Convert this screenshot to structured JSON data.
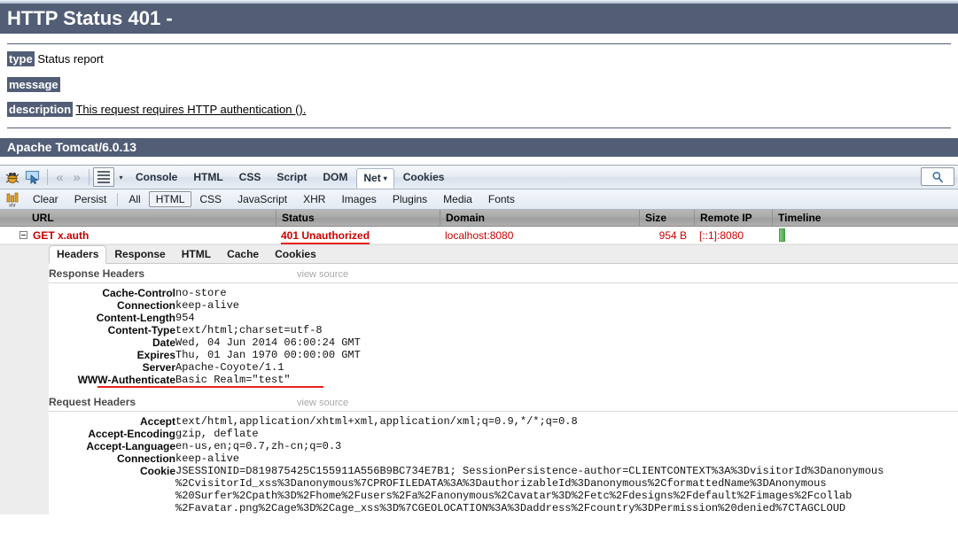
{
  "tomcat": {
    "status_banner": "HTTP Status 401 -",
    "rows": [
      {
        "label": "type",
        "value": "Status report",
        "underline": false
      },
      {
        "label": "message",
        "value": "",
        "underline": false
      },
      {
        "label": "description",
        "value": "This request requires HTTP authentication ().",
        "underline": true
      }
    ],
    "footer": "Apache Tomcat/6.0.13"
  },
  "firebug": {
    "toolbar": {
      "icons": [
        "firebug-bug-icon",
        "inspect-icon"
      ],
      "nav_back": "«",
      "nav_forward": "»",
      "menu_icon": "menu-icon",
      "caret": "▾",
      "tabs": [
        {
          "label": "Console",
          "active": false
        },
        {
          "label": "HTML",
          "active": false
        },
        {
          "label": "CSS",
          "active": false
        },
        {
          "label": "Script",
          "active": false
        },
        {
          "label": "DOM",
          "active": false
        },
        {
          "label": "Net",
          "active": true,
          "caret": "▾"
        },
        {
          "label": "Cookies",
          "active": false
        }
      ],
      "search_icon": "search-icon"
    },
    "subtoolbar": {
      "xhr_icon": "xhr-icon",
      "actions": [
        {
          "label": "Clear",
          "selected": false
        },
        {
          "label": "Persist",
          "selected": false
        }
      ],
      "filters": [
        {
          "label": "All",
          "selected": false
        },
        {
          "label": "HTML",
          "selected": true
        },
        {
          "label": "CSS",
          "selected": false
        },
        {
          "label": "JavaScript",
          "selected": false
        },
        {
          "label": "XHR",
          "selected": false
        },
        {
          "label": "Images",
          "selected": false
        },
        {
          "label": "Plugins",
          "selected": false
        },
        {
          "label": "Media",
          "selected": false
        },
        {
          "label": "Fonts",
          "selected": false
        }
      ]
    },
    "net_table": {
      "columns": [
        "URL",
        "Status",
        "Domain",
        "Size",
        "Remote IP",
        "Timeline"
      ],
      "row": {
        "url": "GET x.auth",
        "status": "401 Unauthorized",
        "domain": "localhost:8080",
        "size": "954 B",
        "remote_ip": "[::1]:8080",
        "timeline": "timeline-bar"
      }
    },
    "detail": {
      "subtabs": [
        {
          "label": "Headers",
          "active": true
        },
        {
          "label": "Response",
          "active": false
        },
        {
          "label": "HTML",
          "active": false
        },
        {
          "label": "Cache",
          "active": false
        },
        {
          "label": "Cookies",
          "active": false
        }
      ],
      "response_section": {
        "title": "Response Headers",
        "view_source": "view source",
        "headers": [
          {
            "name": "Cache-Control",
            "value": "no-store"
          },
          {
            "name": "Connection",
            "value": "keep-alive"
          },
          {
            "name": "Content-Length",
            "value": "954"
          },
          {
            "name": "Content-Type",
            "value": "text/html;charset=utf-8"
          },
          {
            "name": "Date",
            "value": "Wed, 04 Jun 2014 06:00:24 GMT"
          },
          {
            "name": "Expires",
            "value": "Thu, 01 Jan 1970 00:00:00 GMT"
          },
          {
            "name": "Server",
            "value": "Apache-Coyote/1.1"
          },
          {
            "name": "WWW-Authenticate",
            "value": "Basic Realm=\"test\"",
            "highlighted": true
          }
        ]
      },
      "request_section": {
        "title": "Request Headers",
        "view_source": "view source",
        "headers": [
          {
            "name": "Accept",
            "value": "text/html,application/xhtml+xml,application/xml;q=0.9,*/*;q=0.8"
          },
          {
            "name": "Accept-Encoding",
            "value": "gzip, deflate"
          },
          {
            "name": "Accept-Language",
            "value": "en-us,en;q=0.7,zh-cn;q=0.3"
          },
          {
            "name": "Connection",
            "value": "keep-alive"
          },
          {
            "name": "Cookie",
            "value": "JSESSIONID=D819875425C155911A556B9BC734E7B1; SessionPersistence-author=CLIENTCONTEXT%3A%3DvisitorId%3Danonymous\n%2CvisitorId_xss%3Danonymous%7CPROFILEDATA%3A%3DauthorizableId%3Danonymous%2CformattedName%3DAnonymous\n%20Surfer%2Cpath%3D%2Fhome%2Fusers%2Fa%2Fanonymous%2Cavatar%3D%2Fetc%2Fdesigns%2Fdefault%2Fimages%2Fcollab\n%2Favatar.png%2Cage%3D%2Cage_xss%3D%7CGEOLOCATION%3A%3Daddress%2Fcountry%3DPermission%20denied%7CTAGCLOUD"
          }
        ]
      }
    }
  },
  "colors": {
    "tomcat_banner": "#525D76",
    "error_red": "#c80000",
    "underline_red": "#e8221f",
    "timeline_green": "#5fb95f"
  }
}
